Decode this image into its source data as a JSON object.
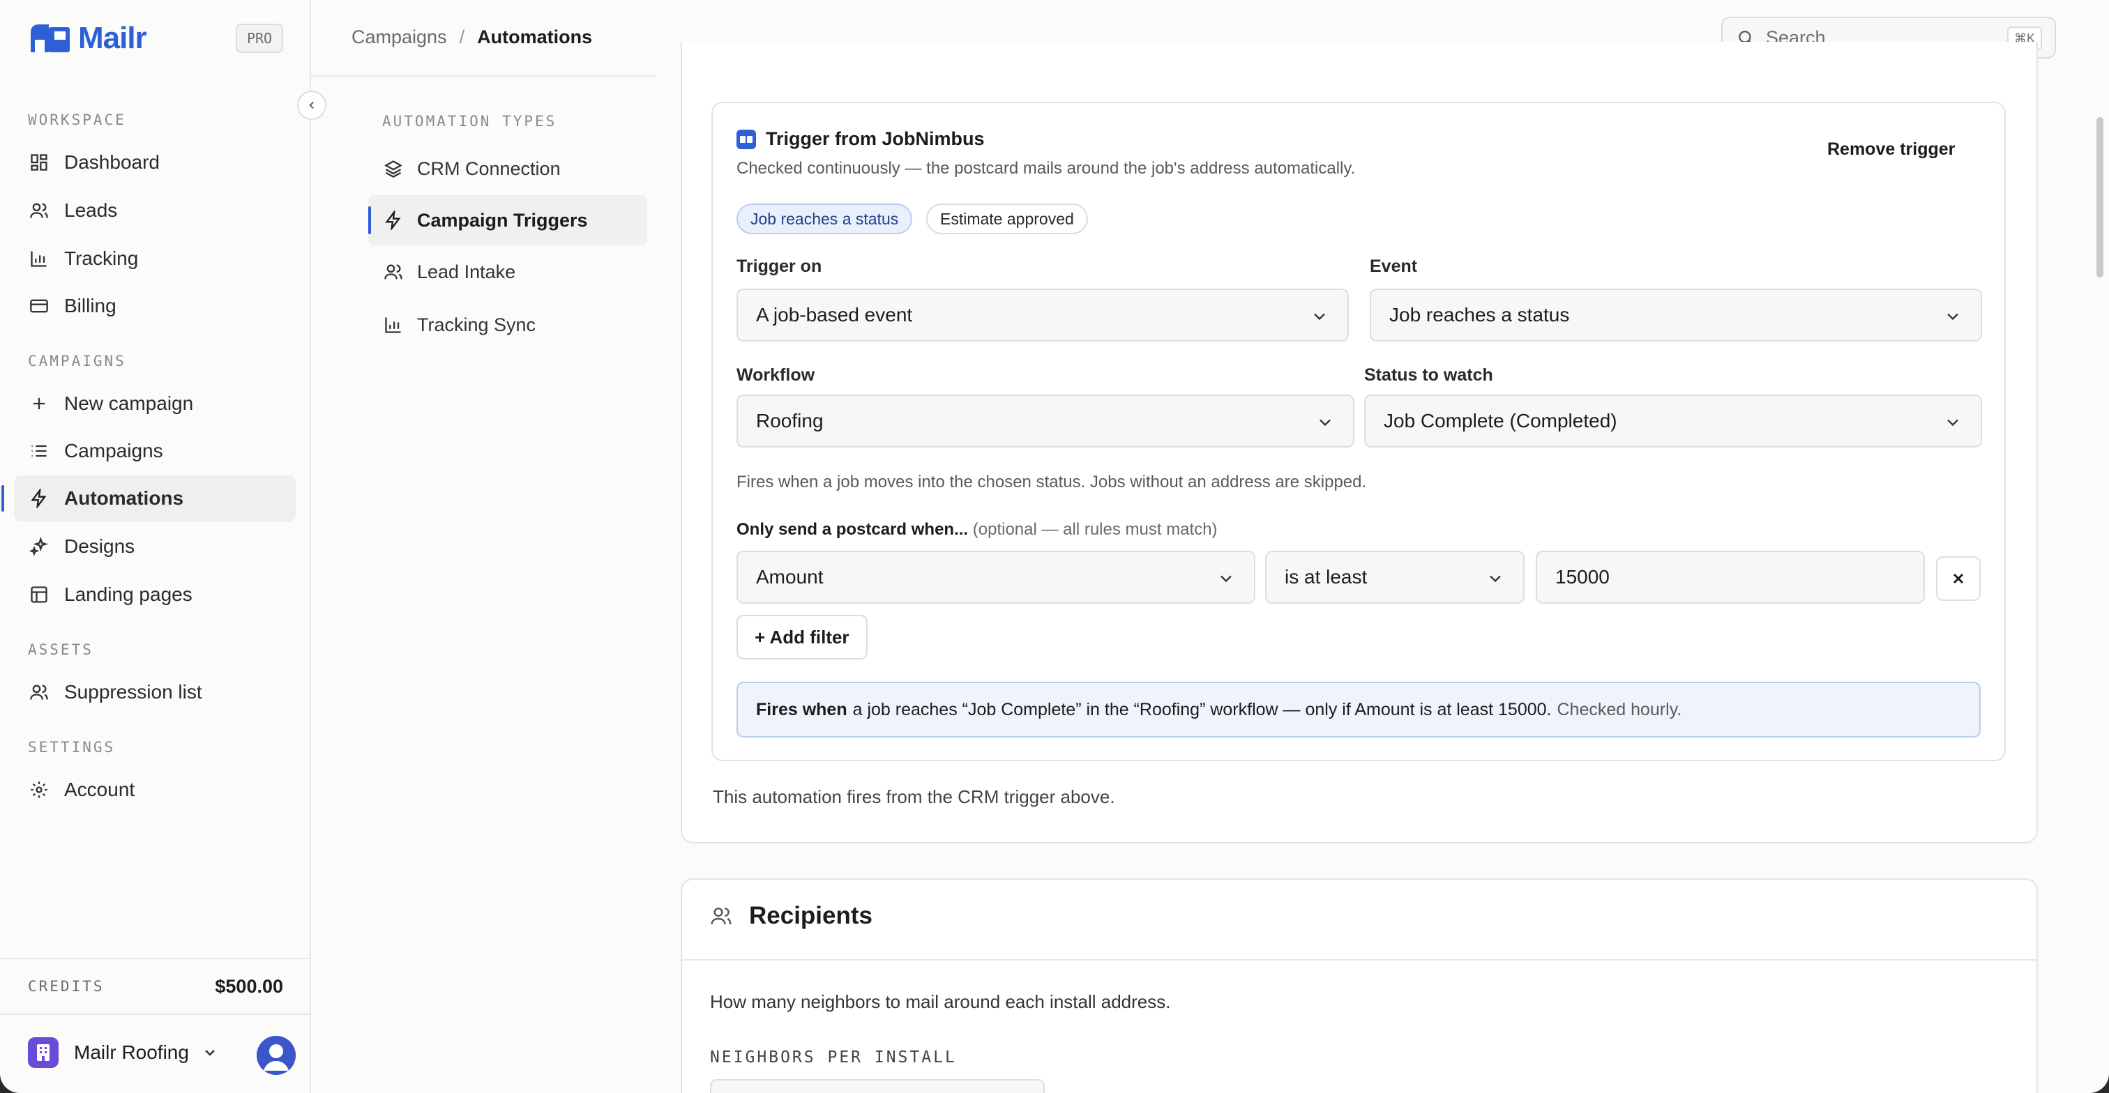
{
  "brand": {
    "name": "Mailr",
    "plan_badge": "PRO",
    "color": "#2f5fd6"
  },
  "sidebar": {
    "sections": [
      {
        "label": "WORKSPACE",
        "items": [
          {
            "label": "Dashboard",
            "icon": "dashboard-icon"
          },
          {
            "label": "Leads",
            "icon": "users-icon"
          },
          {
            "label": "Tracking",
            "icon": "bar-chart-icon"
          },
          {
            "label": "Billing",
            "icon": "credit-card-icon"
          }
        ]
      },
      {
        "label": "CAMPAIGNS",
        "items": [
          {
            "label": "New campaign",
            "icon": "plus-icon"
          },
          {
            "label": "Campaigns",
            "icon": "list-icon"
          },
          {
            "label": "Automations",
            "icon": "lightning-icon",
            "active": true
          },
          {
            "label": "Designs",
            "icon": "sparkles-icon"
          },
          {
            "label": "Landing pages",
            "icon": "layout-icon"
          }
        ]
      },
      {
        "label": "ASSETS",
        "items": [
          {
            "label": "Suppression list",
            "icon": "users-icon"
          }
        ]
      },
      {
        "label": "SETTINGS",
        "items": [
          {
            "label": "Account",
            "icon": "gear-icon"
          }
        ]
      }
    ],
    "credits": {
      "label": "CREDITS",
      "value": "$500.00"
    },
    "org": {
      "name": "Mailr Roofing",
      "logo_color": "#6a4bd8"
    }
  },
  "header": {
    "breadcrumb": {
      "parent": "Campaigns",
      "separator": "/",
      "current": "Automations"
    },
    "search": {
      "placeholder": "Search...",
      "shortcut": "⌘K"
    }
  },
  "subnav": {
    "label": "AUTOMATION TYPES",
    "items": [
      {
        "label": "CRM Connection",
        "icon": "layers-icon"
      },
      {
        "label": "Campaign Triggers",
        "icon": "lightning-icon",
        "active": true
      },
      {
        "label": "Lead Intake",
        "icon": "users-icon"
      },
      {
        "label": "Tracking Sync",
        "icon": "bar-chart-icon"
      }
    ]
  },
  "trigger": {
    "title": "Trigger from JobNimbus",
    "description": "Checked continuously — the postcard mails around the job's address automatically.",
    "remove_label": "Remove trigger",
    "chips": [
      {
        "label": "Job reaches a status",
        "active": true
      },
      {
        "label": "Estimate approved",
        "active": false
      }
    ],
    "trigger_on": {
      "label": "Trigger on",
      "value": "A job-based event"
    },
    "event": {
      "label": "Event",
      "value": "Job reaches a status"
    },
    "workflow": {
      "label": "Workflow",
      "value": "Roofing"
    },
    "status": {
      "label": "Status to watch",
      "value": "Job Complete (Completed)"
    },
    "hint": "Fires when a job moves into the chosen status. Jobs without an address are skipped.",
    "filters_heading": "Only send a postcard when...",
    "filters_heading_note": "(optional — all rules must match)",
    "filter": {
      "field": "Amount",
      "operator": "is at least",
      "value": "15000"
    },
    "add_filter_label": "+ Add filter",
    "summary": {
      "lead": "Fires when",
      "body": "a job reaches “Job Complete” in the “Roofing” workflow — only if Amount is at least 15000.",
      "muted": "Checked hourly."
    },
    "note": "This automation fires from the CRM trigger above."
  },
  "recipients": {
    "title": "Recipients",
    "description": "How many neighbors to mail around each install address.",
    "neighbors_label": "NEIGHBORS PER INSTALL"
  }
}
